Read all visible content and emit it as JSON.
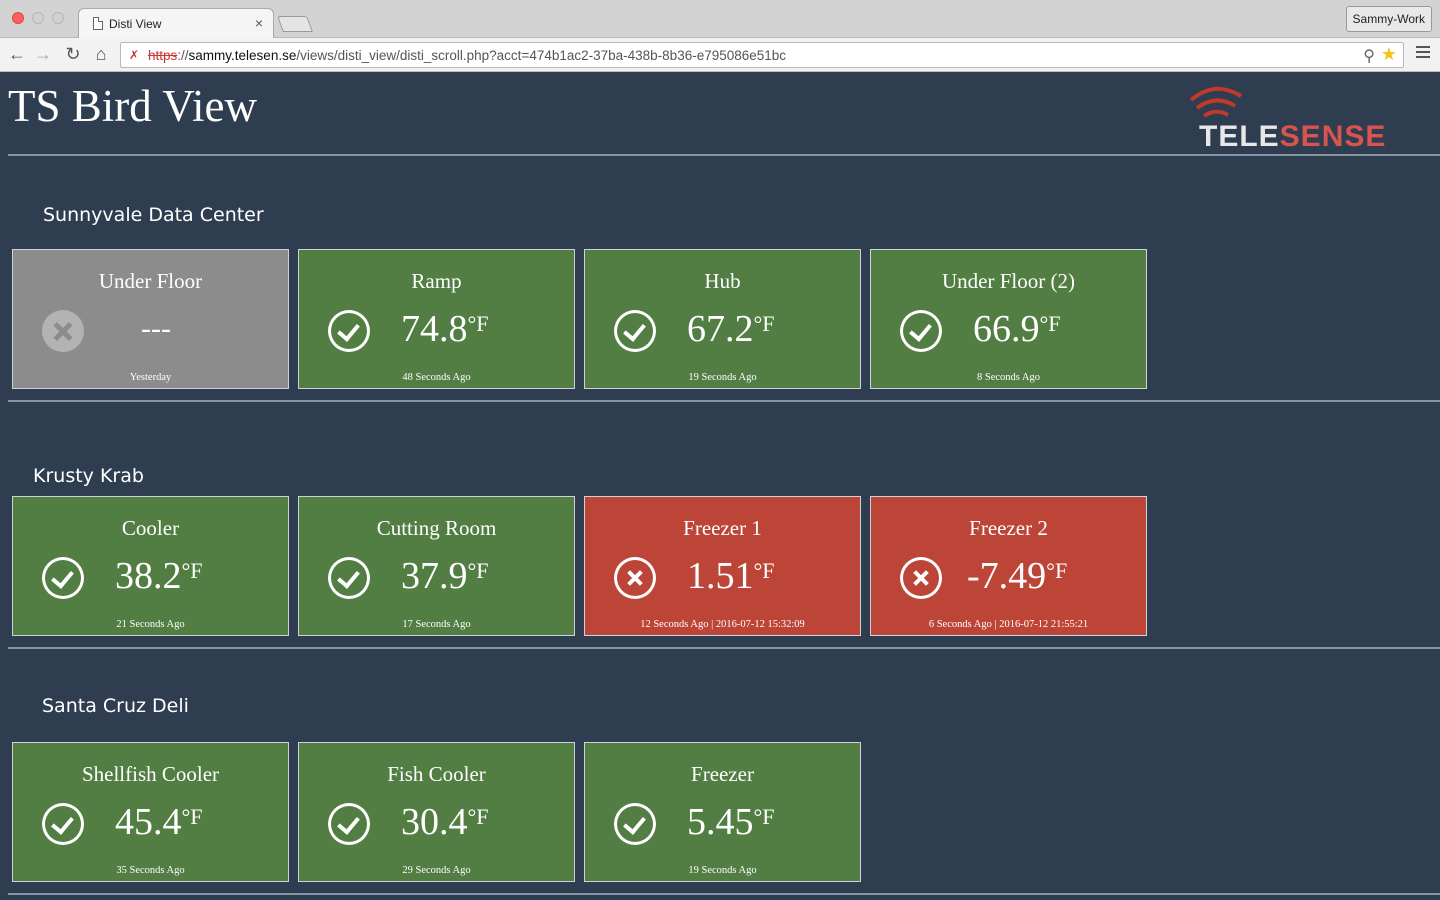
{
  "browser": {
    "tab_title": "Disti View",
    "tab_close": "×",
    "profile": "Sammy-Work",
    "url_scheme": "https",
    "url_sep": "://",
    "url_host": "sammy.telesen.se",
    "url_path": "/views/disti_view/disti_scroll.php?acct=474b1ac2-37ba-438b-8b36-e795086e51bc"
  },
  "page": {
    "title": "TS Bird View",
    "logo_white": "TELE",
    "logo_red": "SENSE"
  },
  "groups": [
    {
      "name": "Sunnyvale Data Center",
      "sensors": [
        {
          "name": "Under Floor",
          "value": "---",
          "unit": "",
          "status": "offline",
          "updated": "Yesterday"
        },
        {
          "name": "Ramp",
          "value": "74.8",
          "unit": "°F",
          "status": "ok",
          "updated": "48 Seconds Ago"
        },
        {
          "name": "Hub",
          "value": "67.2",
          "unit": "°F",
          "status": "ok",
          "updated": "19 Seconds Ago"
        },
        {
          "name": "Under Floor (2)",
          "value": "66.9",
          "unit": "°F",
          "status": "ok",
          "updated": "8 Seconds Ago"
        }
      ]
    },
    {
      "name": "Krusty Krab",
      "sensors": [
        {
          "name": "Cooler",
          "value": "38.2",
          "unit": "°F",
          "status": "ok",
          "updated": "21 Seconds Ago"
        },
        {
          "name": "Cutting Room",
          "value": "37.9",
          "unit": "°F",
          "status": "ok",
          "updated": "17 Seconds Ago"
        },
        {
          "name": "Freezer 1",
          "value": "1.51",
          "unit": "°F",
          "status": "alarm",
          "updated": "12 Seconds Ago | 2016-07-12 15:32:09"
        },
        {
          "name": "Freezer 2",
          "value": "-7.49",
          "unit": "°F",
          "status": "alarm",
          "updated": "6 Seconds Ago | 2016-07-12 21:55:21"
        }
      ]
    },
    {
      "name": "Santa Cruz Deli",
      "sensors": [
        {
          "name": "Shellfish Cooler",
          "value": "45.4",
          "unit": "°F",
          "status": "ok",
          "updated": "35 Seconds Ago"
        },
        {
          "name": "Fish Cooler",
          "value": "30.4",
          "unit": "°F",
          "status": "ok",
          "updated": "29 Seconds Ago"
        },
        {
          "name": "Freezer",
          "value": "5.45",
          "unit": "°F",
          "status": "ok",
          "updated": "19 Seconds Ago"
        }
      ]
    }
  ],
  "colors": {
    "page_bg": "#2f3d50",
    "ok": "#527d43",
    "alarm": "#bd4538",
    "offline": "#8c8c8c",
    "brand": "#d9534f"
  }
}
